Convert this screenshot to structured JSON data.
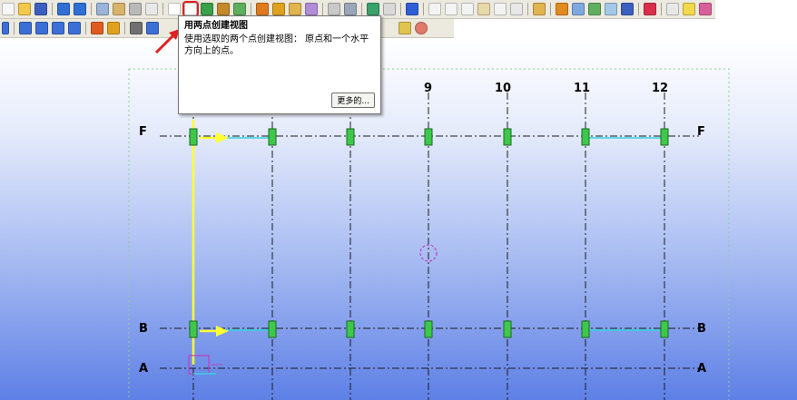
{
  "tooltip": {
    "title": "用两点创建视图",
    "description": "使用选取的两个点创建视图： 原点和一个水平方向上的点。",
    "more_button": "更多的..."
  },
  "grid": {
    "column_labels": [
      "9",
      "10",
      "11",
      "12"
    ],
    "row_labels": {
      "F": "F",
      "B": "B",
      "A": "A"
    }
  },
  "colors": {
    "accent_highlight": "#e02020",
    "grid_line": "#1a1a1a",
    "column_marker": "#3ec84a",
    "selection_line": "#ffff33",
    "link_line": "#33d6e0",
    "cursor_marker": "#c040c0",
    "viewport_gradient_bottom": "#5e80e6"
  },
  "toolbar": {
    "row1_icons": [
      "new-icon",
      "open-icon",
      "save-icon",
      "undo-icon",
      "redo-icon",
      "copy-icon",
      "paste-icon",
      "print-icon",
      "properties-icon",
      "view-icon",
      "create-view-two-points-icon",
      "export-icon",
      "magnet-icon",
      "snap-icon",
      "drawing-icon",
      "report-icon",
      "book-icon",
      "gallery-icon",
      "arrow-icon",
      "tools-icon",
      "select-icon",
      "help-icon",
      "dimension-icon",
      "angle-icon",
      "cross-icon",
      "measure-icon",
      "arc-icon",
      "edit-icon",
      "brush-icon",
      "layers-icon",
      "model-icon",
      "numbers-icon",
      "clash-icon",
      "render-icon",
      "forward-icon",
      "lightbulb-icon",
      "library-icon"
    ],
    "row2_icons": [
      "column-icon",
      "beam-icon",
      "brace-icon",
      "rail-icon",
      "plate-icon",
      "bolt-icon",
      "weld-icon",
      "binoculars-icon",
      "fitting-icon",
      "cut-icon",
      "pen-icon",
      "target-icon"
    ]
  }
}
